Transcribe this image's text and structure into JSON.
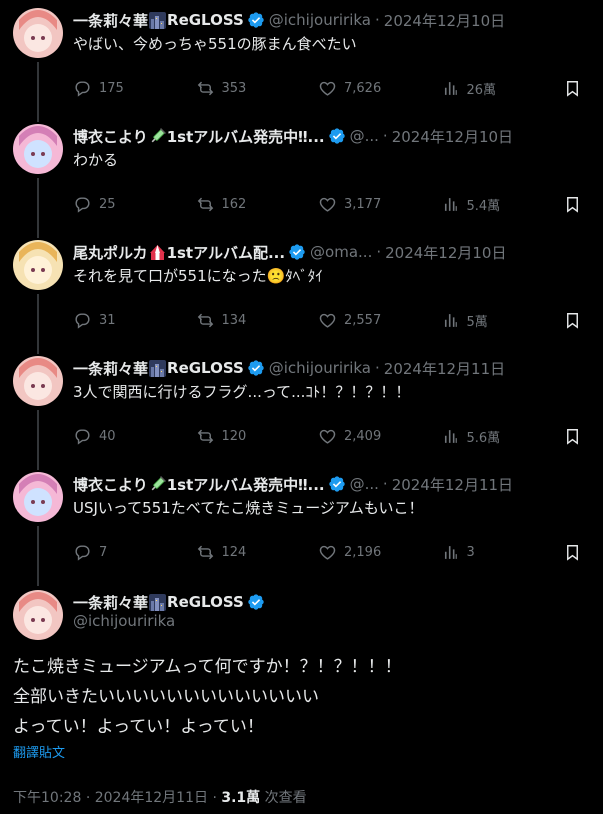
{
  "replies": [
    {
      "name": "一条莉々華",
      "emoji_name": "🌃",
      "name_suffix": "ReGLOSS",
      "handle": "@ichijouririka",
      "date": "2024年12月10日",
      "text": "やばい、今めっちゃ551の豚まん食べたい",
      "replies": "175",
      "reposts": "353",
      "likes": "7,626",
      "views": "26萬",
      "avatar_colors": [
        "#f2c6c2",
        "#e88a85",
        "#fbe7e2"
      ]
    },
    {
      "name": "博衣こより",
      "emoji_name": "💉",
      "name_suffix": "1stアルバム発売中‼...",
      "handle": "@...",
      "date": "2024年12月10日",
      "text": "わかる",
      "replies": "25",
      "reposts": "162",
      "likes": "3,177",
      "views": "5.4萬",
      "avatar_colors": [
        "#f5b8d6",
        "#d47fb6",
        "#cfe2ff"
      ]
    },
    {
      "name": "尾丸ポルカ",
      "emoji_name": "🎪",
      "name_suffix": "1stアルバム配...",
      "handle": "@oma...",
      "date": "2024年12月10日",
      "text": "それを見て口が551になった🙁ﾀﾍﾞﾀｲ",
      "replies": "31",
      "reposts": "134",
      "likes": "2,557",
      "views": "5萬",
      "avatar_colors": [
        "#f6e2b3",
        "#e9b55a",
        "#fff2d8"
      ]
    },
    {
      "name": "一条莉々華",
      "emoji_name": "🌃",
      "name_suffix": "ReGLOSS",
      "handle": "@ichijouririka",
      "date": "2024年12月11日",
      "text": "3人で関西に行けるフラグ...って...ｺﾄ！？！？！！",
      "replies": "40",
      "reposts": "120",
      "likes": "2,409",
      "views": "5.6萬",
      "avatar_colors": [
        "#f2c6c2",
        "#e88a85",
        "#fbe7e2"
      ]
    },
    {
      "name": "博衣こより",
      "emoji_name": "💉",
      "name_suffix": "1stアルバム発売中‼...",
      "handle": "@...",
      "date": "2024年12月11日",
      "text": "USJいって551たべてたこ焼きミュージアムもいこ！",
      "replies": "7",
      "reposts": "124",
      "likes": "2,196",
      "views": "3",
      "avatar_colors": [
        "#f5b8d6",
        "#d47fb6",
        "#cfe2ff"
      ]
    }
  ],
  "main": {
    "name": "一条莉々華",
    "emoji_name": "🌃",
    "name_suffix": "ReGLOSS",
    "handle": "@ichijouririka",
    "lines": [
      "たこ焼きミュージアムって何ですか！？！？！！！",
      "全部いきたいいいいいいいいいいいいい",
      "よってい！よってい！よってい！"
    ],
    "translate_label": "翻譯貼文",
    "time": "下午10:28",
    "date": "2024年12月11日",
    "views": "3.1萬",
    "views_label": "次查看",
    "avatar_colors": [
      "#f2c6c2",
      "#e88a85",
      "#fbe7e2"
    ]
  },
  "separator": "·",
  "icons": {
    "reply": "reply-icon",
    "repost": "repost-icon",
    "like": "heart-icon",
    "views": "views-icon",
    "bookmark": "bookmark-icon",
    "verified": "verified-badge-icon"
  },
  "colors": {
    "background": "#000000",
    "text": "#e7e9ea",
    "muted": "#71767b",
    "accent": "#1d9bf0",
    "thread_line": "#333639"
  }
}
